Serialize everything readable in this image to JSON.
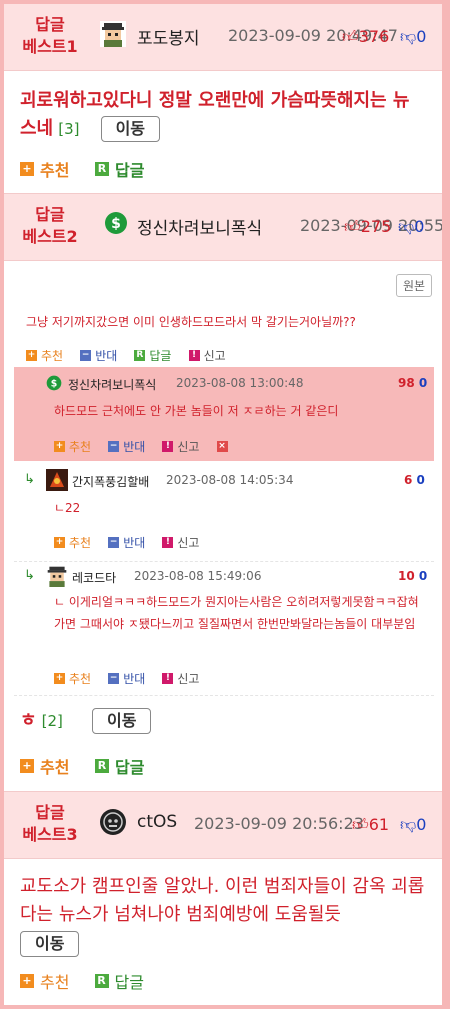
{
  "posts": [
    {
      "badge_line1": "답글",
      "badge_line2": "베스트1",
      "username": "포도봉지",
      "date": "2023-09-09 20:49:47",
      "up": "376",
      "down": "0",
      "text": "괴로워하고있다니 정말 오랜만에 가슴따뜻해지는 뉴스네",
      "count": "[3]",
      "move": "이동",
      "recommend": "추천",
      "reply": "답글",
      "avatar_icon": "pixel-character-icon"
    },
    {
      "badge_line1": "답글",
      "badge_line2": "베스트2",
      "username": "정신차려보니폭식",
      "date": "2023-09-09 20:55:47",
      "up": "275",
      "down": "0",
      "avatar_icon": "dollar-coin-icon",
      "original_button": "원본",
      "quote_text": "그냥 저기까지갔으면 이미 인생하드모드라서 막 갈기는거아닐까??",
      "quote_actions": [
        "추천",
        "반대",
        "답글",
        "신고"
      ],
      "replies": [
        {
          "username": "정신차려보니폭식",
          "date": "2023-08-08 13:00:48",
          "up": "98",
          "down": "0",
          "text": "하드모드 근처에도 안 가본 놈들이 저 ㅈㄹ하는 거 같은디",
          "actions": [
            "추천",
            "반대",
            "신고"
          ]
        },
        {
          "username": "간지폭풍김할배",
          "date": "2023-08-08 14:05:34",
          "up": "6",
          "down": "0",
          "text": "ㄴ22",
          "actions": [
            "추천",
            "반대",
            "신고"
          ]
        },
        {
          "username": "레코드타",
          "date": "2023-08-08 15:49:06",
          "up": "10",
          "down": "0",
          "text": "ㄴ 이게리얼ㅋㅋㅋ하드모드가 뭔지아는사람은 오히려저렇게못함ㅋㅋ잡혀가면 그때서야 ㅈ됐다느끼고 질질짜면서 한번만봐달라는놈들이 대부분임",
          "actions": [
            "추천",
            "반대",
            "신고"
          ]
        }
      ],
      "text": "ㅎ",
      "count": "[2]",
      "move": "이동",
      "recommend": "추천",
      "reply": "답글"
    },
    {
      "badge_line1": "답글",
      "badge_line2": "베스트3",
      "username": "ctOS",
      "date": "2023-09-09 20:56:23",
      "up": "61",
      "down": "0",
      "avatar_icon": "dedsec-skull-icon",
      "text": "교도소가 캠프인줄 알았나. 이런 범죄자들이 감옥 괴롭다는 뉴스가 넘쳐나야 범죄예방에 도움될듯",
      "move": "이동",
      "recommend": "추천",
      "reply": "답글"
    }
  ],
  "colors": {
    "border": "#f6b7b7",
    "header_bg": "#fde1e1",
    "badge_red": "#d0212c",
    "down_blue": "#1a3fbf",
    "recommend_orange": "#e8811e",
    "reply_green": "#2e8b2e",
    "highlight_row": "#f7b9b9"
  }
}
